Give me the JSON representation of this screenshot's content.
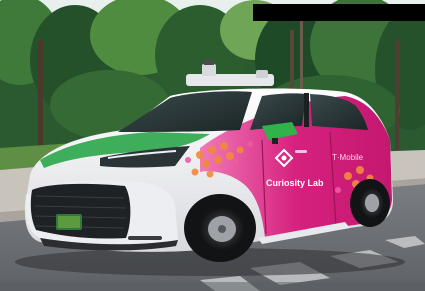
{
  "image": {
    "subject": "autonomous-minivan",
    "palette": {
      "vehicle_body": "#f4f4f6",
      "livery_magenta": "#d6217e",
      "livery_pink": "#ee5aa5",
      "livery_orange": "#f08a3c",
      "hood_green": "#3fae5a",
      "mirror_green": "#2fb34a",
      "road": "#6f7277",
      "sidewalk": "#c9c4bb",
      "foliage_dark": "#1f4a28",
      "foliage_light": "#5f9a45",
      "sky": "#dfe9e6",
      "redaction": "#000000"
    },
    "icon": "self-driving-car-icon"
  },
  "vehicle": {
    "door_brand": "Curiosity Lab",
    "rear_brand": "T·Mobile"
  }
}
